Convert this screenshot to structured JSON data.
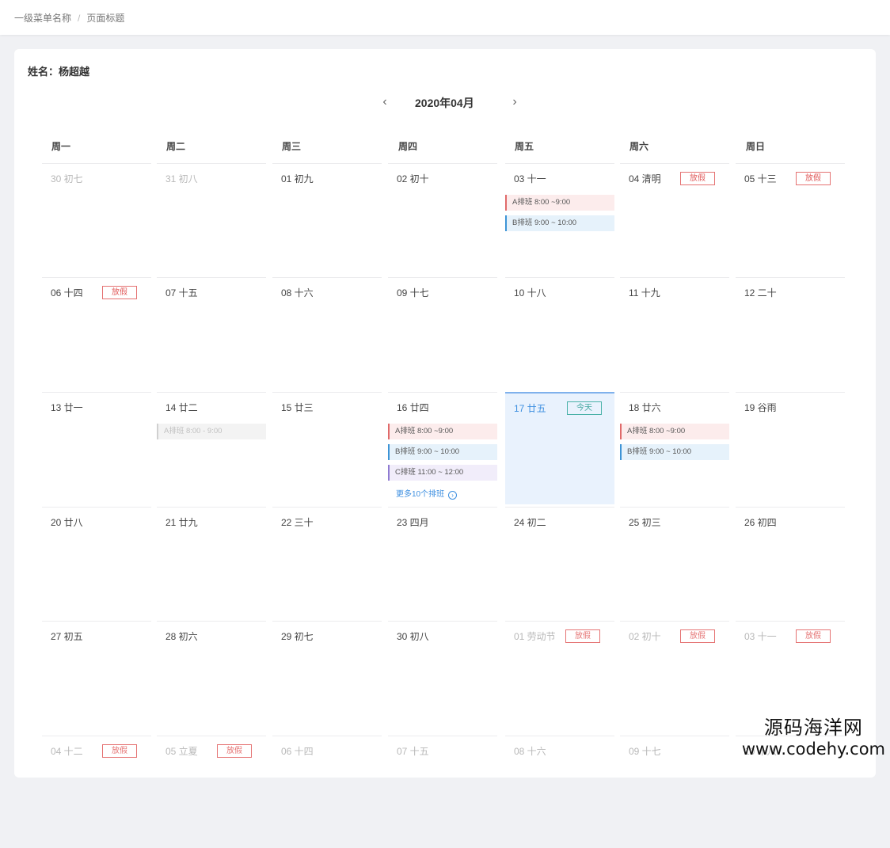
{
  "breadcrumb": {
    "level1": "一级菜单名称",
    "separator": "/",
    "current": "页面标题"
  },
  "employee": {
    "name_line": "姓名：杨超越"
  },
  "calendar": {
    "month_title": "2020年04月",
    "prev_icon": "‹",
    "next_icon": "›",
    "weekdays": [
      "周一",
      "周二",
      "周三",
      "周四",
      "周五",
      "周六",
      "周日"
    ],
    "holiday_text": "放假",
    "today_text": "今天",
    "weeks": [
      [
        {
          "label": "30  初七",
          "other": true
        },
        {
          "label": "31  初八",
          "other": true
        },
        {
          "label": "01  初九"
        },
        {
          "label": "02  初十"
        },
        {
          "label": "03  十一",
          "shifts": [
            {
              "type": "a",
              "text": "A排班 8:00 ~9:00"
            },
            {
              "type": "b",
              "text": "B排班 9:00 ~ 10:00"
            }
          ]
        },
        {
          "label": "04  清明",
          "holiday": true
        },
        {
          "label": "05  十三",
          "holiday": true
        }
      ],
      [
        {
          "label": "06  十四",
          "holiday": true
        },
        {
          "label": "07  十五"
        },
        {
          "label": "08  十六"
        },
        {
          "label": "09  十七"
        },
        {
          "label": "10  十八"
        },
        {
          "label": "11  十九"
        },
        {
          "label": "12  二十"
        }
      ],
      [
        {
          "label": "13  廿一"
        },
        {
          "label": "14  廿二",
          "shifts": [
            {
              "type": "grey",
              "text": "A排班 8:00 - 9:00"
            }
          ]
        },
        {
          "label": "15  廿三"
        },
        {
          "label": "16  廿四",
          "shifts": [
            {
              "type": "a",
              "text": "A排班 8:00 ~9:00"
            },
            {
              "type": "b",
              "text": "B排班 9:00 ~ 10:00"
            },
            {
              "type": "c",
              "text": "C排班 11:00 ~ 12:00"
            }
          ],
          "more": "更多10个排班"
        },
        {
          "label": "17  廿五",
          "today": true
        },
        {
          "label": "18  廿六",
          "shifts": [
            {
              "type": "a",
              "text": "A排班 8:00 ~9:00"
            },
            {
              "type": "b",
              "text": "B排班 9:00 ~ 10:00"
            }
          ]
        },
        {
          "label": "19  谷雨"
        }
      ],
      [
        {
          "label": "20  廿八"
        },
        {
          "label": "21  廿九"
        },
        {
          "label": "22  三十"
        },
        {
          "label": "23  四月"
        },
        {
          "label": "24  初二"
        },
        {
          "label": "25  初三"
        },
        {
          "label": "26  初四"
        }
      ],
      [
        {
          "label": "27  初五"
        },
        {
          "label": "28  初六"
        },
        {
          "label": "29  初七"
        },
        {
          "label": "30  初八"
        },
        {
          "label": "01  劳动节",
          "other": true,
          "holiday": true
        },
        {
          "label": "02  初十",
          "other": true,
          "holiday": true
        },
        {
          "label": "03  十一",
          "other": true,
          "holiday": true
        }
      ],
      [
        {
          "label": "04  十二",
          "other": true,
          "holiday": true
        },
        {
          "label": "05  立夏",
          "other": true,
          "holiday": true
        },
        {
          "label": "06  十四",
          "other": true
        },
        {
          "label": "07  十五",
          "other": true
        },
        {
          "label": "08  十六",
          "other": true
        },
        {
          "label": "09  十七",
          "other": true
        },
        {
          "label": "10  十八",
          "other": true
        }
      ]
    ]
  },
  "watermark": {
    "line1": "源码海洋网",
    "line2": "www.codehy.com"
  }
}
